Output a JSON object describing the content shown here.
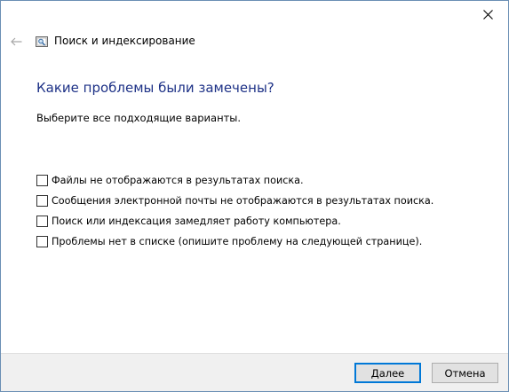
{
  "window": {
    "close_icon": "close-icon"
  },
  "nav": {
    "back_icon": "back-arrow-icon",
    "app_icon": "search-indexing-icon",
    "title": "Поиск и индексирование"
  },
  "main": {
    "heading": "Какие проблемы были замечены?",
    "subtitle": "Выберите все подходящие варианты.",
    "options": [
      {
        "label": "Файлы не отображаются в результатах поиска.",
        "checked": false
      },
      {
        "label": "Сообщения электронной почты не отображаются в результатах поиска.",
        "checked": false
      },
      {
        "label": "Поиск или индексация замедляет работу компьютера.",
        "checked": false
      },
      {
        "label": "Проблемы нет в списке (опишите проблему на следующей странице).",
        "checked": false
      }
    ]
  },
  "footer": {
    "next_label": "Далее",
    "cancel_label": "Отмена"
  },
  "colors": {
    "heading": "#1e3287",
    "accent": "#0078d7",
    "footer_bg": "#f0f0f0"
  }
}
